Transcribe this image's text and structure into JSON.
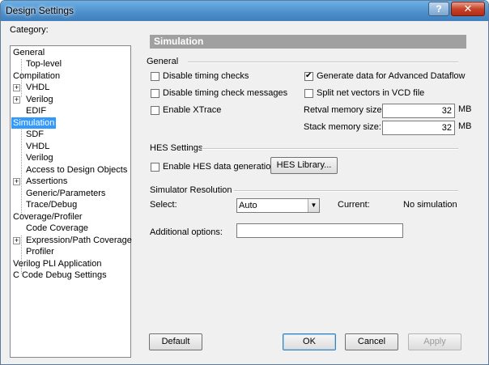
{
  "window": {
    "title": "Design Settings",
    "help": "?",
    "close": "✕"
  },
  "category_label": "Category:",
  "tree": [
    {
      "label": "General"
    },
    {
      "label": "Top-level"
    },
    {
      "label": "Compilation"
    },
    {
      "label": "VHDL"
    },
    {
      "label": "Verilog"
    },
    {
      "label": "EDIF"
    },
    {
      "label": "Simulation"
    },
    {
      "label": "SDF"
    },
    {
      "label": "VHDL"
    },
    {
      "label": "Verilog"
    },
    {
      "label": "Access to Design Objects"
    },
    {
      "label": "Assertions"
    },
    {
      "label": "Generic/Parameters"
    },
    {
      "label": "Trace/Debug"
    },
    {
      "label": "Coverage/Profiler"
    },
    {
      "label": "Code Coverage"
    },
    {
      "label": "Expression/Path Coverage"
    },
    {
      "label": "Profiler"
    },
    {
      "label": "Verilog PLI Application"
    },
    {
      "label": "C Code Debug Settings"
    }
  ],
  "panel": {
    "header": "Simulation",
    "general": {
      "label": "General",
      "disable_timing_checks": "Disable timing checks",
      "disable_timing_check_messages": "Disable timing check messages",
      "enable_xtrace": "Enable XTrace",
      "generate_dataflow": "Generate data for Advanced Dataflow",
      "split_net_vectors": "Split net vectors in VCD file",
      "retval_label": "Retval memory size:",
      "retval_value": "32",
      "retval_unit": "MB",
      "stack_label": "Stack memory size:",
      "stack_value": "32",
      "stack_unit": "MB"
    },
    "hes": {
      "label": "HES Settings",
      "enable_hes": "Enable HES data generation",
      "library_button": "HES Library..."
    },
    "resolution": {
      "label": "Simulator Resolution",
      "select_label": "Select:",
      "select_value": "Auto",
      "current_label": "Current:",
      "current_value": "No simulation",
      "additional_label": "Additional options:",
      "additional_value": ""
    }
  },
  "buttons": {
    "default": "Default",
    "ok": "OK",
    "cancel": "Cancel",
    "apply": "Apply"
  }
}
